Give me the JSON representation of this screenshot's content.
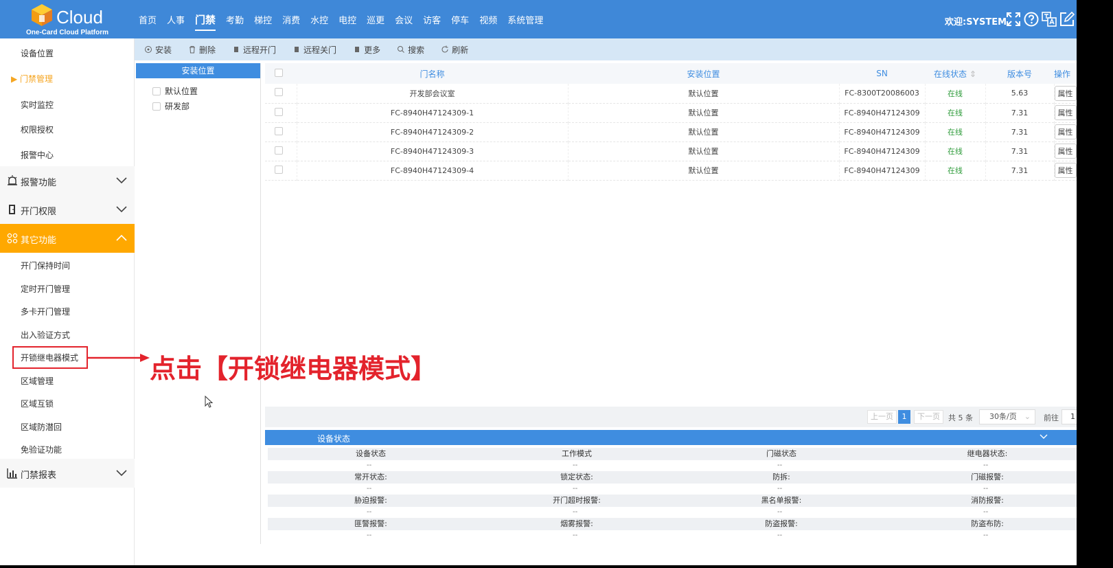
{
  "header": {
    "brand": "Cloud",
    "subtitle": "One-Card Cloud Platform",
    "nav": [
      "首页",
      "人事",
      "门禁",
      "考勤",
      "梯控",
      "消费",
      "水控",
      "电控",
      "巡更",
      "会议",
      "访客",
      "停车",
      "视频",
      "系统管理"
    ],
    "active_nav": "门禁",
    "welcome": "欢迎:SYSTEM",
    "icons": [
      "fullscreen-icon",
      "help-icon",
      "translate-icon",
      "edit-icon"
    ]
  },
  "sidebar": {
    "top_items": [
      "设备位置",
      "门禁管理",
      "实时监控",
      "权限授权",
      "报警中心"
    ],
    "active_item": "门禁管理",
    "groups": {
      "alarm": "报警功能",
      "door_perm": "开门权限",
      "other": "其它功能",
      "report": "门禁报表"
    },
    "other_items": [
      "开门保持时间",
      "定时开门管理",
      "多卡开门管理",
      "出入验证方式",
      "开锁继电器模式",
      "区域管理",
      "区域互锁",
      "区域防潜回",
      "免验证功能"
    ]
  },
  "toolbar": {
    "buttons": [
      "安装",
      "删除",
      "远程开门",
      "远程关门",
      "更多",
      "搜索",
      "刷新"
    ]
  },
  "locations": {
    "title": "安装位置",
    "items": [
      "默认位置",
      "研发部"
    ]
  },
  "table": {
    "headers": [
      "门名称",
      "安装位置",
      "SN",
      "在线状态",
      "版本号",
      "操作"
    ],
    "rows": [
      [
        "开发部会议室",
        "默认位置",
        "FC-8300T20086003",
        "在线",
        "5.63",
        "属性"
      ],
      [
        "FC-8940H47124309-1",
        "默认位置",
        "FC-8940H47124309",
        "在线",
        "7.31",
        "属性"
      ],
      [
        "FC-8940H47124309-2",
        "默认位置",
        "FC-8940H47124309",
        "在线",
        "7.31",
        "属性"
      ],
      [
        "FC-8940H47124309-3",
        "默认位置",
        "FC-8940H47124309",
        "在线",
        "7.31",
        "属性"
      ],
      [
        "FC-8940H47124309-4",
        "默认位置",
        "FC-8940H47124309",
        "在线",
        "7.31",
        "属性"
      ]
    ]
  },
  "pager": {
    "prev": "上一页",
    "current": "1",
    "next": "下一页",
    "total": "共 5 条",
    "page_size": "30条/页",
    "goto": "前往",
    "goto_value": "1"
  },
  "device_status": {
    "title": "设备状态",
    "rows": [
      [
        "设备状态",
        "工作模式",
        "门磁状态",
        "继电器状态:"
      ],
      [
        "常开状态:",
        "锁定状态:",
        "防拆:",
        "门磁报警:"
      ],
      [
        "胁迫报警:",
        "开门超时报警:",
        "黑名单报警:",
        "消防报警:"
      ],
      [
        "匪警报警:",
        "烟雾报警:",
        "防盗报警:",
        "防盗布防:"
      ]
    ],
    "empty_value": "--"
  },
  "annotation": {
    "text": "点击【开锁继电器模式】"
  },
  "colors": {
    "header_blue": "#3f88d8",
    "accent_orange": "#ffa800",
    "annotation_red": "#e3232c",
    "online_green": "#2e9b3a"
  }
}
